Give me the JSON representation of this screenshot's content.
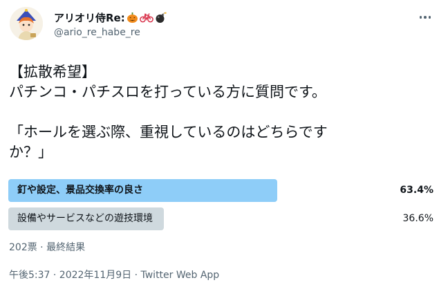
{
  "author": {
    "display_name": "アリオリ侍Re:",
    "handle": "@ario_re_habe_re",
    "avatar_icon": "anime-avatar-icon",
    "name_emojis": [
      "pumpkin-emoji",
      "bicycle-emoji",
      "bomb-emoji"
    ]
  },
  "tweet": {
    "lines": [
      "【拡散希望】",
      "パチンコ・パチスロを打っている方に質問です。",
      "",
      "「ホールを選ぶ際、重視しているのはどちらです",
      "か？」"
    ]
  },
  "poll": {
    "options": [
      {
        "label": "釘や設定、景品交換率の良さ",
        "percent_text": "63.4%",
        "percent": 63.4,
        "winner": true
      },
      {
        "label": "設備やサービスなどの遊技環境",
        "percent_text": "36.6%",
        "percent": 36.6,
        "winner": false
      }
    ],
    "summary": "202票 · 最終結果"
  },
  "meta": {
    "timestamp": "午後5:37 · 2022年11月9日 · Twitter Web App"
  },
  "colors": {
    "winner_bar": "#8ecdf8",
    "loser_bar": "#cfd9de",
    "secondary_text": "#536471",
    "primary_text": "#0f1419"
  }
}
